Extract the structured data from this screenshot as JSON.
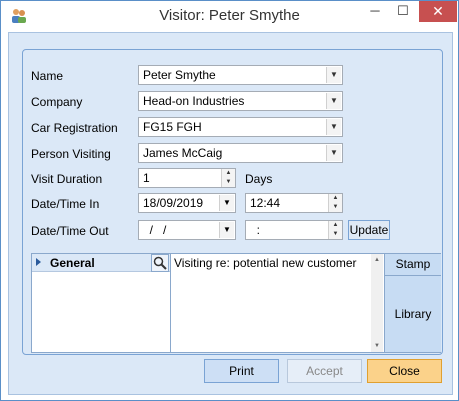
{
  "window": {
    "title": "Visitor: Peter Smythe",
    "minimize": "─",
    "maximize": "☐",
    "close": "✕"
  },
  "form": {
    "name_label": "Name",
    "name_value": "Peter Smythe",
    "company_label": "Company",
    "company_value": "Head-on Industries",
    "car_label": "Car Registration",
    "car_value": "FG15 FGH",
    "person_label": "Person Visiting",
    "person_value": "James McCaig",
    "duration_label": "Visit Duration",
    "duration_value": "1",
    "duration_unit": "Days",
    "in_label": "Date/Time In",
    "in_date": "18/09/2019",
    "in_time": "12:44",
    "out_label": "Date/Time Out",
    "out_date": "  /   /",
    "out_time": "  :",
    "update_label": "Update"
  },
  "lower": {
    "tree_header": "General",
    "notes": "Visiting re: potential new customer",
    "stamp_label": "Stamp",
    "library_label": "Library"
  },
  "buttons": {
    "print": "Print",
    "accept": "Accept",
    "close": "Close"
  }
}
